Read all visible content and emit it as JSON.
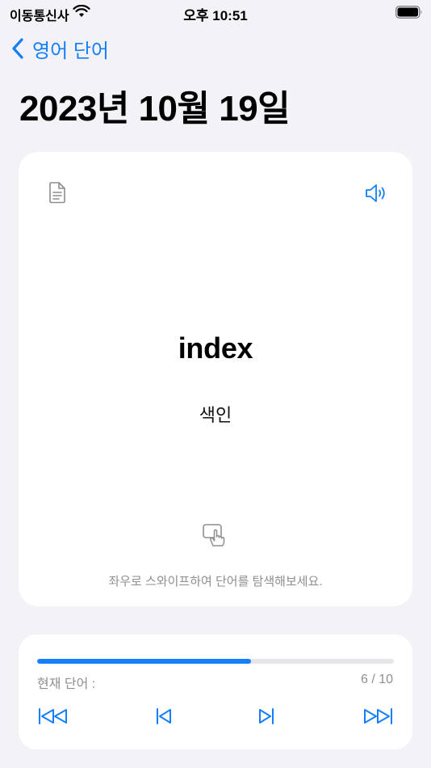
{
  "status_bar": {
    "carrier": "이동통신사",
    "time": "오후 10:51"
  },
  "nav": {
    "back_label": "영어 단어"
  },
  "page": {
    "title": "2023년 10월 19일"
  },
  "card": {
    "word": "index",
    "meaning": "색인",
    "hint": "좌우로 스와이프하여 단어를 탐색해보세요."
  },
  "progress": {
    "current_label": "현재 단어 :",
    "current_index": 6,
    "total": 10,
    "count_text": "6 / 10"
  },
  "colors": {
    "accent": "#147efb",
    "background": "#f2f2f7",
    "secondary_text": "#8e8e93"
  }
}
